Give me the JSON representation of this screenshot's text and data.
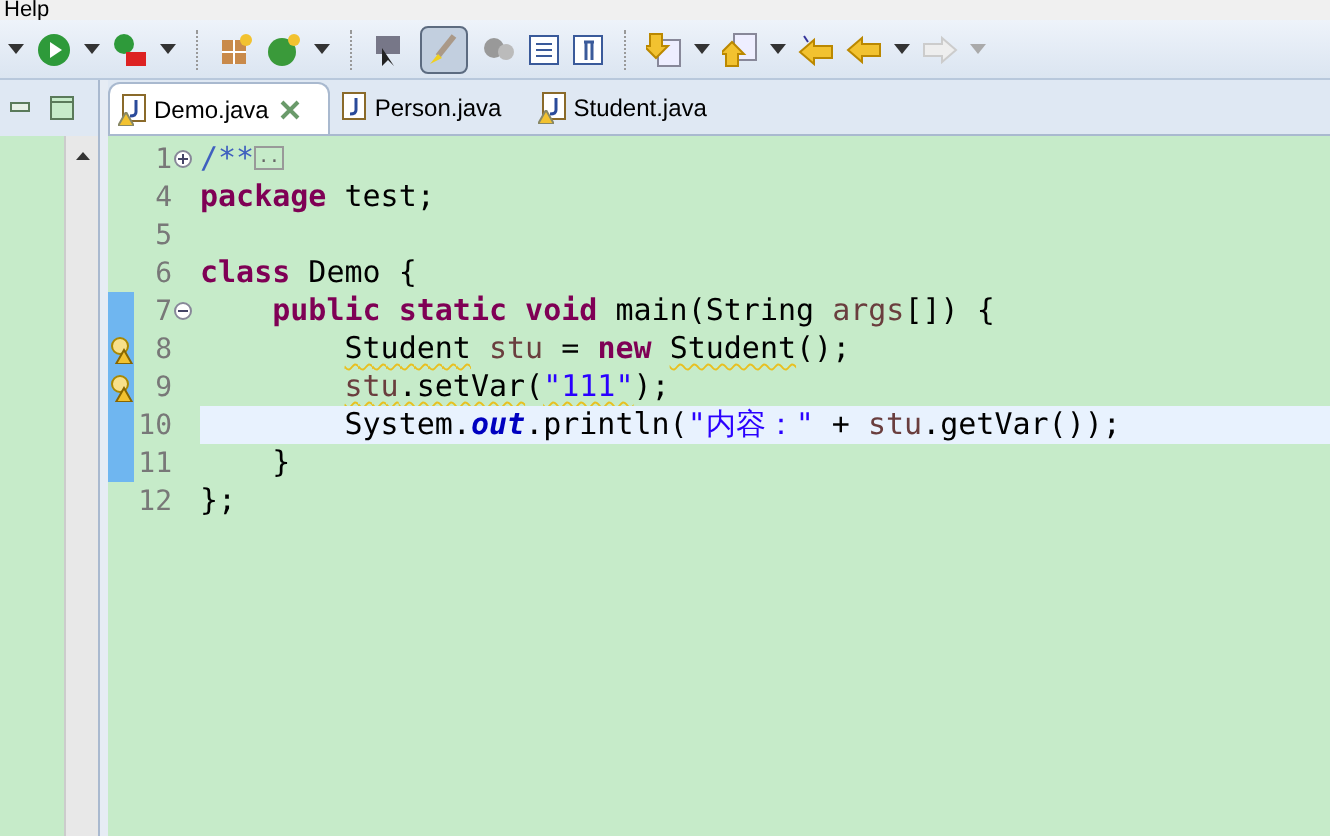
{
  "menu": [
    "Help"
  ],
  "toolbar": {
    "highlight_toggle_on": true
  },
  "tabs": [
    {
      "label": "Demo.java",
      "selected": true,
      "warning": true
    },
    {
      "label": "Person.java",
      "selected": false,
      "warning": false
    },
    {
      "label": "Student.java",
      "selected": false,
      "warning": true
    }
  ],
  "editor": {
    "lines": [
      {
        "number": "1",
        "folded": true,
        "changed": false,
        "warning": false,
        "current": false,
        "tokens": [
          {
            "kind": "comment",
            "text": "/**"
          },
          {
            "kind": "fold_box",
            "text": ".."
          }
        ]
      },
      {
        "number": "4",
        "changed": false,
        "warning": false,
        "current": false,
        "tokens": [
          {
            "kind": "keyword",
            "text": "package"
          },
          {
            "kind": "plain",
            "text": " test;"
          }
        ]
      },
      {
        "number": "5",
        "changed": false,
        "warning": false,
        "current": false
      },
      {
        "number": "6",
        "changed": false,
        "warning": false,
        "current": false,
        "tokens": [
          {
            "kind": "keyword",
            "text": "class"
          },
          {
            "kind": "plain",
            "text": " Demo {"
          }
        ]
      },
      {
        "number": "7",
        "folded": false,
        "changed": true,
        "warning": false,
        "current": false,
        "tokens": [
          {
            "kind": "keyword",
            "text": "    public"
          },
          {
            "kind": "keyword",
            "text": " static"
          },
          {
            "kind": "keyword",
            "text": " void"
          },
          {
            "kind": "plain",
            "text": " main(String "
          },
          {
            "kind": "local",
            "text": "args"
          },
          {
            "kind": "plain",
            "text": "[]) {"
          }
        ]
      },
      {
        "number": "8",
        "changed": true,
        "warning": true,
        "current": false,
        "tokens": [
          {
            "kind": "plain",
            "text": "        Student",
            "squiggle": true
          },
          {
            "kind": "local",
            "text": " stu"
          },
          {
            "kind": "plain",
            "text": " = "
          },
          {
            "kind": "keyword",
            "text": "new"
          },
          {
            "kind": "plain",
            "text": " Student",
            "squiggle": true
          },
          {
            "kind": "plain",
            "text": "();"
          }
        ]
      },
      {
        "number": "9",
        "changed": true,
        "warning": true,
        "current": false,
        "tokens": [
          {
            "kind": "local",
            "text": "        stu",
            "squiggle": true
          },
          {
            "kind": "plain",
            "text": ".setVar",
            "squiggle": true
          },
          {
            "kind": "plain",
            "text": "("
          },
          {
            "kind": "string",
            "text": "\"111\"",
            "squiggle": true
          },
          {
            "kind": "plain",
            "text": ");"
          }
        ]
      },
      {
        "number": "10",
        "changed": true,
        "warning": false,
        "current": true,
        "tokens": [
          {
            "kind": "plain",
            "text": "        System."
          },
          {
            "kind": "field",
            "text": "out"
          },
          {
            "kind": "plain",
            "text": ".println("
          },
          {
            "kind": "string",
            "text": "\"内容：\""
          },
          {
            "kind": "plain",
            "text": " + "
          },
          {
            "kind": "local",
            "text": "stu"
          },
          {
            "kind": "plain",
            "text": ".getVar());"
          }
        ]
      },
      {
        "number": "11",
        "changed": true,
        "warning": false,
        "current": false,
        "tokens": [
          {
            "kind": "plain",
            "text": "    }"
          }
        ]
      },
      {
        "number": "12",
        "changed": false,
        "warning": false,
        "current": false,
        "tokens": [
          {
            "kind": "plain",
            "text": "};"
          }
        ]
      }
    ]
  }
}
